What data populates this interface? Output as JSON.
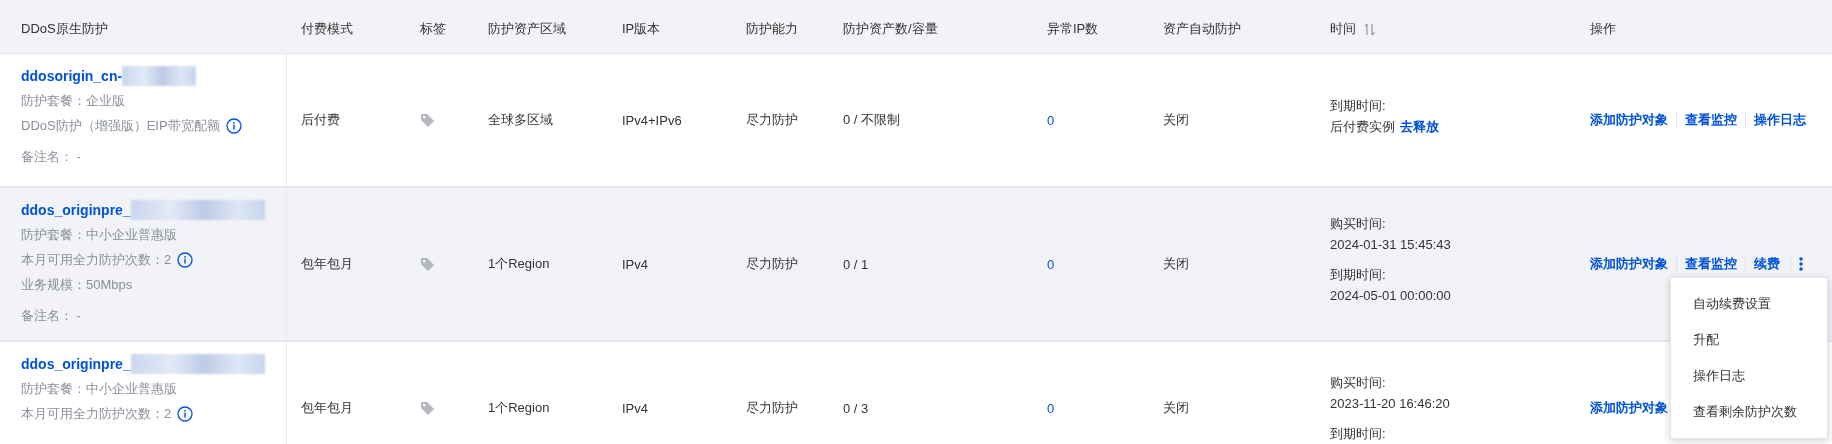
{
  "table": {
    "columns": [
      {
        "label": "DDoS原生防护",
        "sortable": false
      },
      {
        "label": "付费模式",
        "sortable": false
      },
      {
        "label": "标签",
        "sortable": false
      },
      {
        "label": "防护资产区域",
        "sortable": false
      },
      {
        "label": "IP版本",
        "sortable": false
      },
      {
        "label": "防护能力",
        "sortable": false
      },
      {
        "label": "防护资产数/容量",
        "sortable": false
      },
      {
        "label": "异常IP数",
        "sortable": false
      },
      {
        "label": "资产自动防护",
        "sortable": false
      },
      {
        "label": "时间",
        "sortable": true
      },
      {
        "label": "操作",
        "sortable": false
      }
    ],
    "rows": [
      {
        "highlighted": false,
        "name": "ddosorigin_cn-",
        "redacted": true,
        "details": [
          {
            "text": "防护套餐：企业版",
            "info": false
          },
          {
            "text": "DDoS防护（增强版）EIP带宽配额",
            "info": true
          },
          {
            "text": "备注名： -",
            "info": false
          }
        ],
        "billing": "后付费",
        "region": "全球多区域",
        "ip_version": "IPv4+IPv6",
        "capability": "尽力防护",
        "assets": "0 / 不限制",
        "abnormal_ips": "0",
        "auto_protect": "关闭",
        "time": [
          {
            "label": "到期时间:",
            "value": "后付费实例",
            "link": "去释放"
          }
        ],
        "actions": [
          "添加防护对象",
          "查看监控",
          "操作日志"
        ],
        "more": false
      },
      {
        "highlighted": true,
        "name": "ddos_originpre_",
        "redacted": true,
        "details": [
          {
            "text": "防护套餐：中小企业普惠版",
            "info": false
          },
          {
            "text": "本月可用全力防护次数：2",
            "info": true
          },
          {
            "text": "业务规模：50Mbps",
            "info": false
          },
          {
            "text": "备注名： -",
            "info": false
          }
        ],
        "billing": "包年包月",
        "region": "1个Region",
        "ip_version": "IPv4",
        "capability": "尽力防护",
        "assets": "0 / 1",
        "abnormal_ips": "0",
        "auto_protect": "关闭",
        "time": [
          {
            "label": "购买时间:",
            "value": "2024-01-31 15:45:43"
          },
          {
            "label": "到期时间:",
            "value": "2024-05-01 00:00:00"
          }
        ],
        "actions": [
          "添加防护对象",
          "查看监控",
          "续费"
        ],
        "more": true,
        "menu": [
          "自动续费设置",
          "升配",
          "操作日志",
          "查看剩余防护次数"
        ]
      },
      {
        "highlighted": false,
        "name": "ddos_originpre_",
        "redacted": true,
        "details": [
          {
            "text": "防护套餐：中小企业普惠版",
            "info": false
          },
          {
            "text": "本月可用全力防护次数：2",
            "info": true
          }
        ],
        "billing": "包年包月",
        "region": "1个Region",
        "ip_version": "IPv4",
        "capability": "尽力防护",
        "assets": "0 / 3",
        "abnormal_ips": "0",
        "auto_protect": "关闭",
        "time": [
          {
            "label": "购买时间:",
            "value": "2023-11-20 16:46:20"
          },
          {
            "label": "到期时间:"
          }
        ],
        "actions": [
          "添加防护对象"
        ],
        "more": false
      }
    ]
  }
}
